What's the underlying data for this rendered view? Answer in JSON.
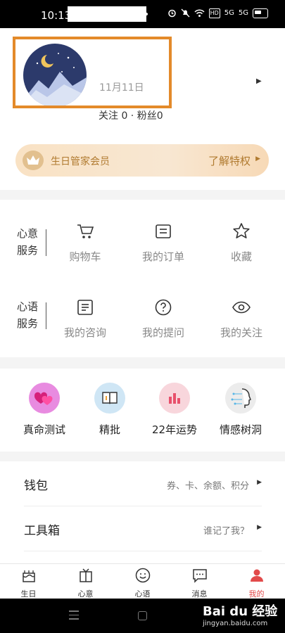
{
  "status_bar": {
    "time": "10:13",
    "icons": [
      "alarm-icon",
      "mute-icon",
      "wifi-icon",
      "hd-icon",
      "signal-5g-icon",
      "signal-5g-icon",
      "battery-icon"
    ],
    "hd_label": "HD",
    "g1_label": "5G",
    "g2_label": "5G"
  },
  "profile": {
    "date": "11月11日",
    "follow_text": "关注 0 · 粉丝0",
    "vip": {
      "title": "生日管家会员",
      "link": "了解特权"
    }
  },
  "services": {
    "group1": {
      "category": [
        "心意",
        "服务"
      ],
      "items": [
        {
          "label": "购物车",
          "icon": "cart-icon"
        },
        {
          "label": "我的订单",
          "icon": "order-icon"
        },
        {
          "label": "收藏",
          "icon": "star-icon"
        }
      ]
    },
    "group2": {
      "category": [
        "心语",
        "服务"
      ],
      "items": [
        {
          "label": "我的咨询",
          "icon": "consult-icon"
        },
        {
          "label": "我的提问",
          "icon": "question-icon"
        },
        {
          "label": "我的关注",
          "icon": "eye-icon"
        }
      ]
    }
  },
  "features": [
    {
      "label": "真命测试",
      "icon": "hearts-icon",
      "color": "#e88be0"
    },
    {
      "label": "精批",
      "icon": "book-icon",
      "color": "#cfe6f5"
    },
    {
      "label": "22年运势",
      "icon": "bar-chart-icon",
      "color": "#f8d6dc"
    },
    {
      "label": "情感树洞",
      "icon": "head-network-icon",
      "color": "#ececec"
    }
  ],
  "menu": [
    {
      "title": "钱包",
      "value": "券、卡、余额、积分"
    },
    {
      "title": "工具箱",
      "value": "谁记了我？"
    }
  ],
  "tabs": [
    {
      "label": "生日",
      "icon": "cake-icon"
    },
    {
      "label": "心意",
      "icon": "gift-icon"
    },
    {
      "label": "心语",
      "icon": "smile-icon"
    },
    {
      "label": "消息",
      "icon": "message-icon"
    },
    {
      "label": "我的",
      "icon": "user-icon",
      "active": true
    }
  ],
  "watermark": {
    "brand": "Bai du 经验",
    "site": "jingyan.baidu.com"
  },
  "colors": {
    "accent": "#e24a4a",
    "highlight_border": "#e38a2a",
    "vip_text": "#b07a2f"
  }
}
